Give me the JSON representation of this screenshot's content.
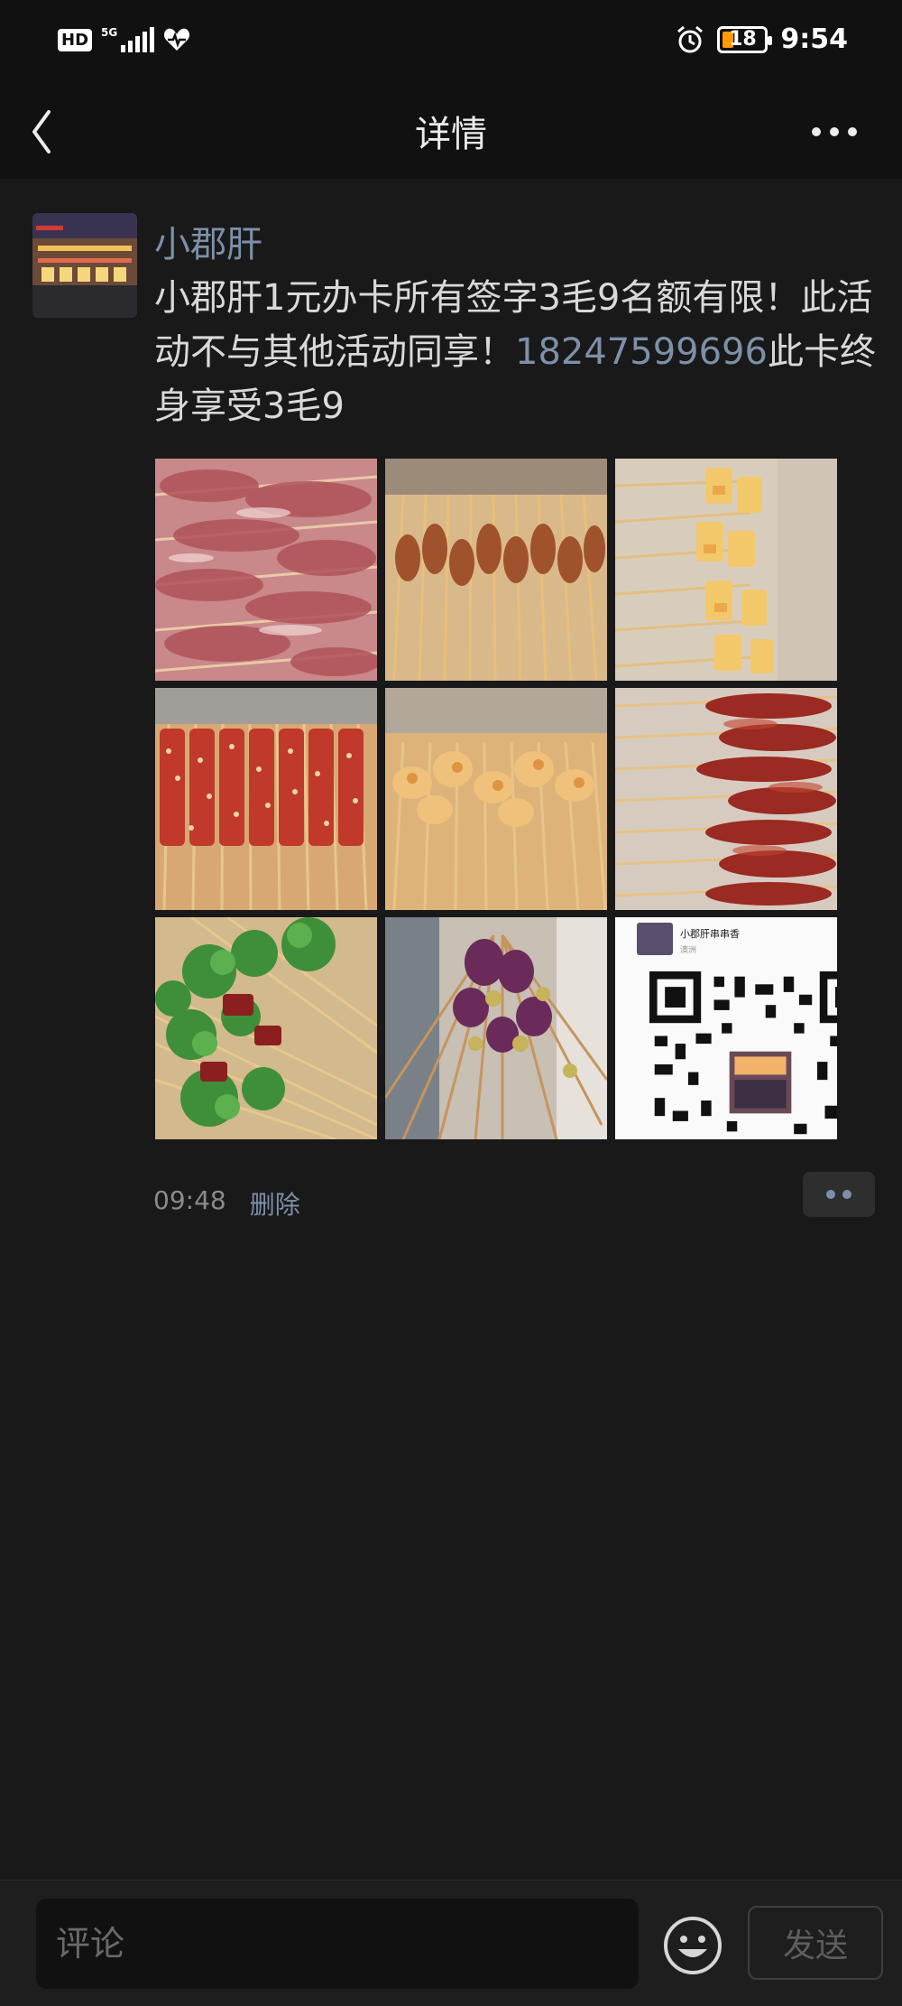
{
  "status_bar": {
    "hd_label": "HD",
    "network_label": "5G",
    "battery_level": "18",
    "time": "9:54",
    "icons": [
      "signal-icon",
      "heart-rate-icon",
      "alarm-icon",
      "battery-icon"
    ]
  },
  "nav": {
    "title": "详情",
    "back_icon": "chevron-left-icon",
    "more_icon": "more-dots-icon"
  },
  "post": {
    "author": "小郡肝",
    "content_before": "小郡肝1元办卡所有签字3毛9名额有限！此活动不与其他活动同享！",
    "phone": "18247599696",
    "content_after": "此卡终身享受3毛9",
    "images": [
      {
        "alt": "raw meat skewers"
      },
      {
        "alt": "seasoned meat skewers"
      },
      {
        "alt": "tofu skewers"
      },
      {
        "alt": "chili meat skewers"
      },
      {
        "alt": "chicken skewers"
      },
      {
        "alt": "sauced meat skewers"
      },
      {
        "alt": "cilantro beef skewers"
      },
      {
        "alt": "purple skewers"
      },
      {
        "alt": "qr code card"
      }
    ],
    "qr_card": {
      "name": "小郡肝串串香",
      "sub": "澳洲"
    },
    "time": "09:48",
    "delete_label": "删除"
  },
  "bottom_bar": {
    "comment_placeholder": "评论",
    "send_label": "发送",
    "emoji_icon": "emoji-smile-icon"
  },
  "colors": {
    "background": "#191919",
    "header": "#111111",
    "link": "#7d90a9",
    "text": "#d9d9d9"
  }
}
